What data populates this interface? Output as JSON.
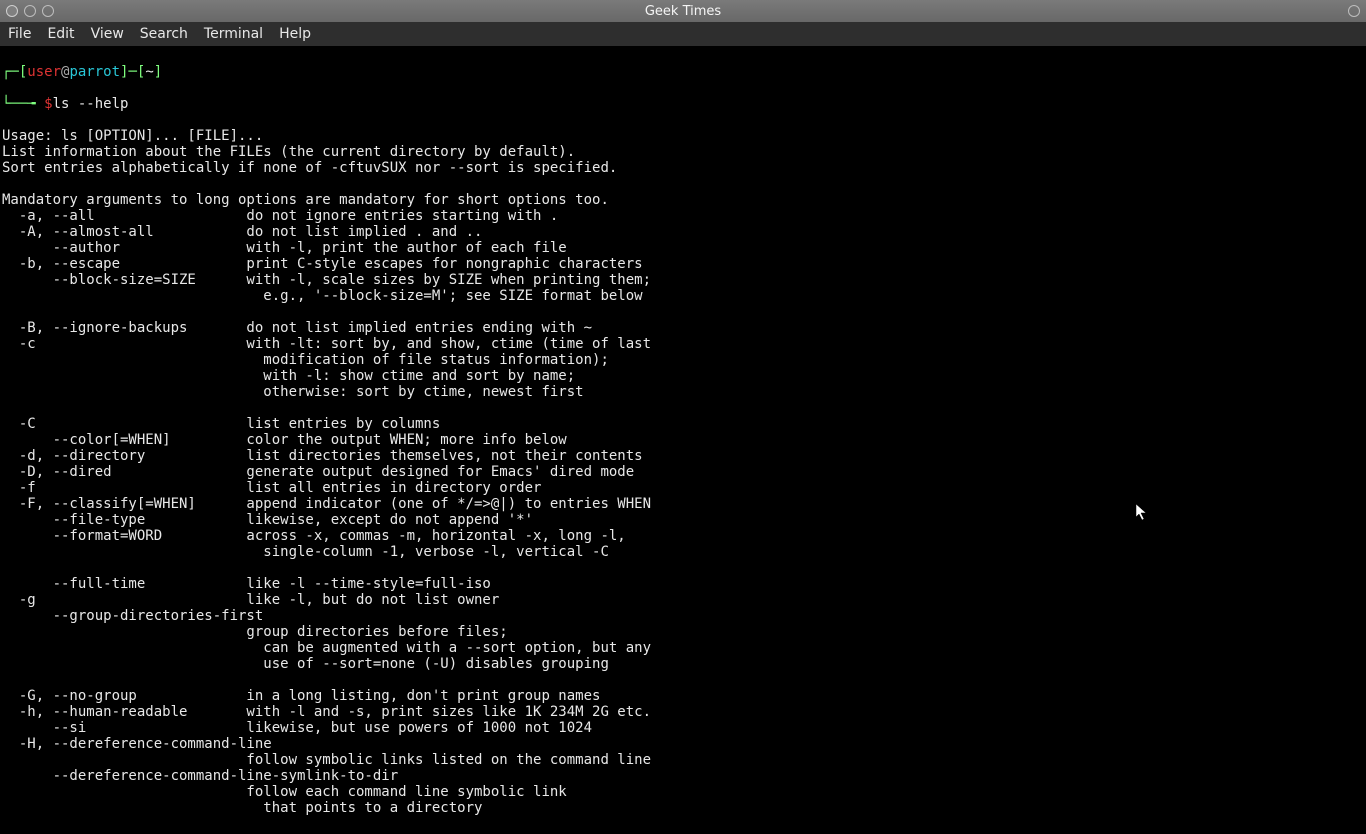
{
  "titlebar": {
    "title": "Geek Times"
  },
  "menubar": {
    "file": "File",
    "edit": "Edit",
    "view": "View",
    "search": "Search",
    "terminal": "Terminal",
    "help": "Help"
  },
  "prompt": {
    "l1_open": "┌─[",
    "user": "user",
    "at": "@",
    "host": "parrot",
    "l1_mid": "]─[",
    "cwd": "~",
    "l1_close": "]",
    "l2_arrow": "└──╼ ",
    "dollar": "$",
    "command": "ls --help"
  },
  "help_lines": [
    "Usage: ls [OPTION]... [FILE]...",
    "List information about the FILEs (the current directory by default).",
    "Sort entries alphabetically if none of -cftuvSUX nor --sort is specified.",
    "",
    "Mandatory arguments to long options are mandatory for short options too.",
    "  -a, --all                  do not ignore entries starting with .",
    "  -A, --almost-all           do not list implied . and ..",
    "      --author               with -l, print the author of each file",
    "  -b, --escape               print C-style escapes for nongraphic characters",
    "      --block-size=SIZE      with -l, scale sizes by SIZE when printing them;",
    "                               e.g., '--block-size=M'; see SIZE format below",
    "",
    "  -B, --ignore-backups       do not list implied entries ending with ~",
    "  -c                         with -lt: sort by, and show, ctime (time of last",
    "                               modification of file status information);",
    "                               with -l: show ctime and sort by name;",
    "                               otherwise: sort by ctime, newest first",
    "",
    "  -C                         list entries by columns",
    "      --color[=WHEN]         color the output WHEN; more info below",
    "  -d, --directory            list directories themselves, not their contents",
    "  -D, --dired                generate output designed for Emacs' dired mode",
    "  -f                         list all entries in directory order",
    "  -F, --classify[=WHEN]      append indicator (one of */=>@|) to entries WHEN",
    "      --file-type            likewise, except do not append '*'",
    "      --format=WORD          across -x, commas -m, horizontal -x, long -l,",
    "                               single-column -1, verbose -l, vertical -C",
    "",
    "      --full-time            like -l --time-style=full-iso",
    "  -g                         like -l, but do not list owner",
    "      --group-directories-first",
    "                             group directories before files;",
    "                               can be augmented with a --sort option, but any",
    "                               use of --sort=none (-U) disables grouping",
    "",
    "  -G, --no-group             in a long listing, don't print group names",
    "  -h, --human-readable       with -l and -s, print sizes like 1K 234M 2G etc.",
    "      --si                   likewise, but use powers of 1000 not 1024",
    "  -H, --dereference-command-line",
    "                             follow symbolic links listed on the command line",
    "      --dereference-command-line-symlink-to-dir",
    "                             follow each command line symbolic link",
    "                               that points to a directory"
  ]
}
